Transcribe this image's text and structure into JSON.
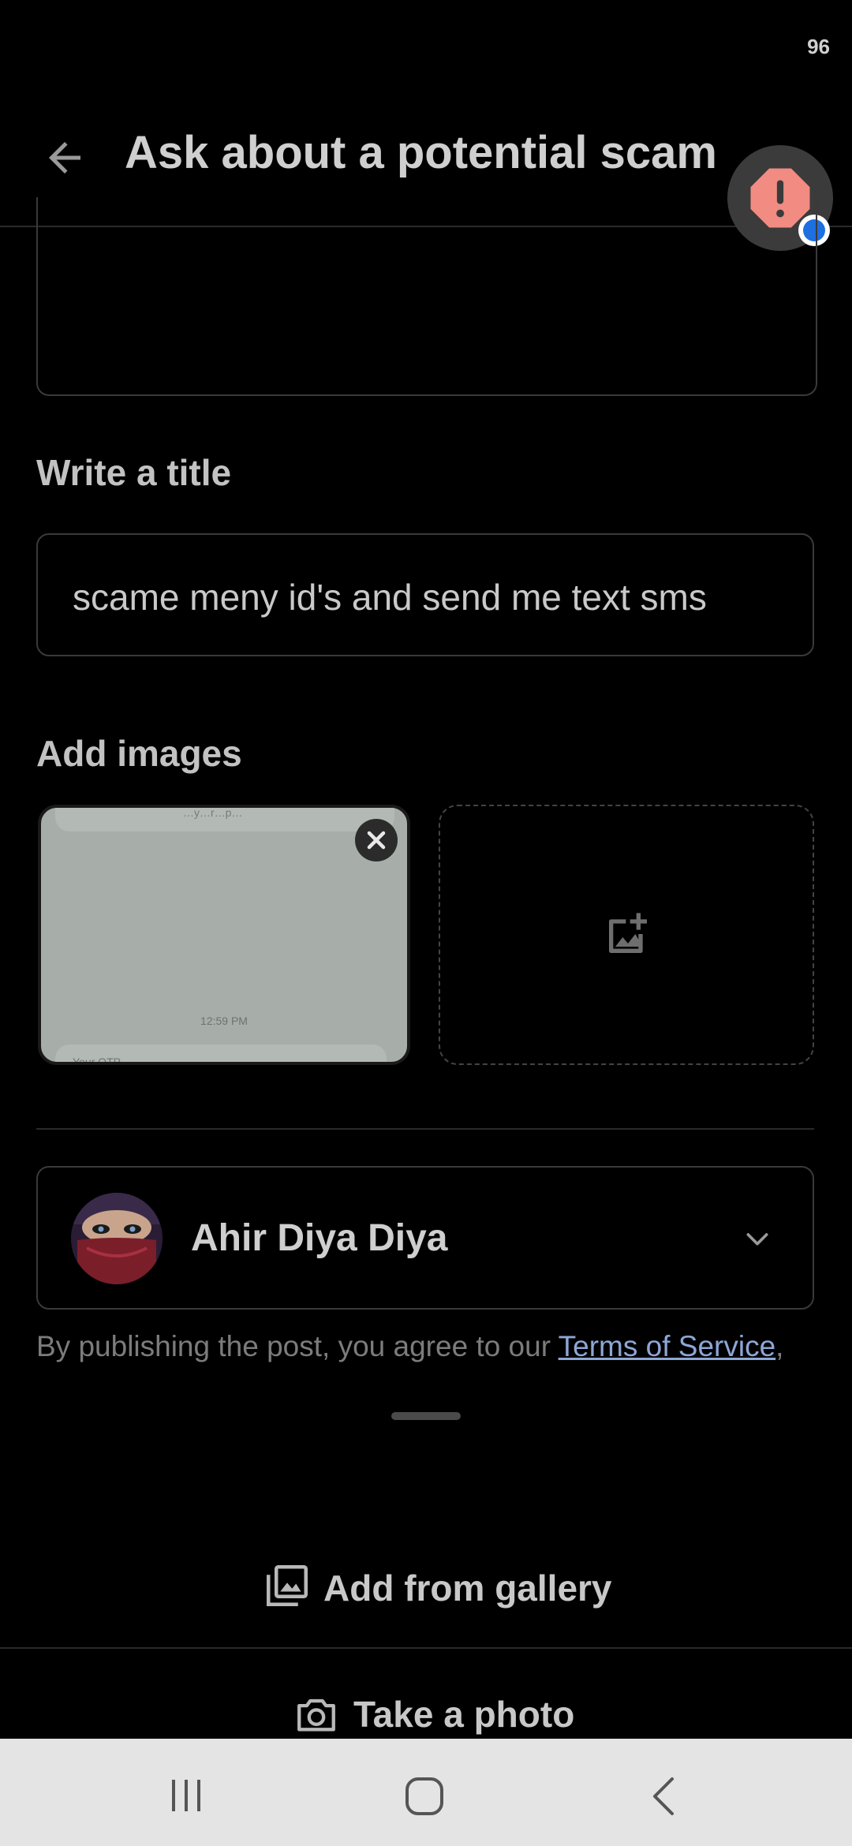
{
  "status_bar": {
    "battery": "96"
  },
  "header": {
    "title": "Ask about a potential scam"
  },
  "form": {
    "title_label": "Write a title",
    "title_value": "scame meny id's and send me text  sms",
    "images_label": "Add images",
    "image_thumb": {
      "timestamp": "12:59 PM",
      "fragment_top": "…y…r…p…",
      "fragment_bottom": "Your OTP… …"
    }
  },
  "account": {
    "name": "Ahir Diya Diya"
  },
  "terms": {
    "prefix": "By publishing the post, you agree to our ",
    "link": "Terms of Service",
    "suffix": ","
  },
  "sheet": {
    "gallery_label": "Add from gallery",
    "photo_label": "Take a photo"
  },
  "icons": {
    "back": "arrow-left-icon",
    "alert": "alert-icon",
    "remove": "close-icon",
    "add_image": "add-photo-icon",
    "chevron": "chevron-down-icon",
    "gallery": "gallery-icon",
    "camera": "camera-icon"
  },
  "colors": {
    "background": "#000000",
    "alert_red": "#f28b82",
    "link": "#8da6d6",
    "nav_bar": "#e4e4e4"
  }
}
